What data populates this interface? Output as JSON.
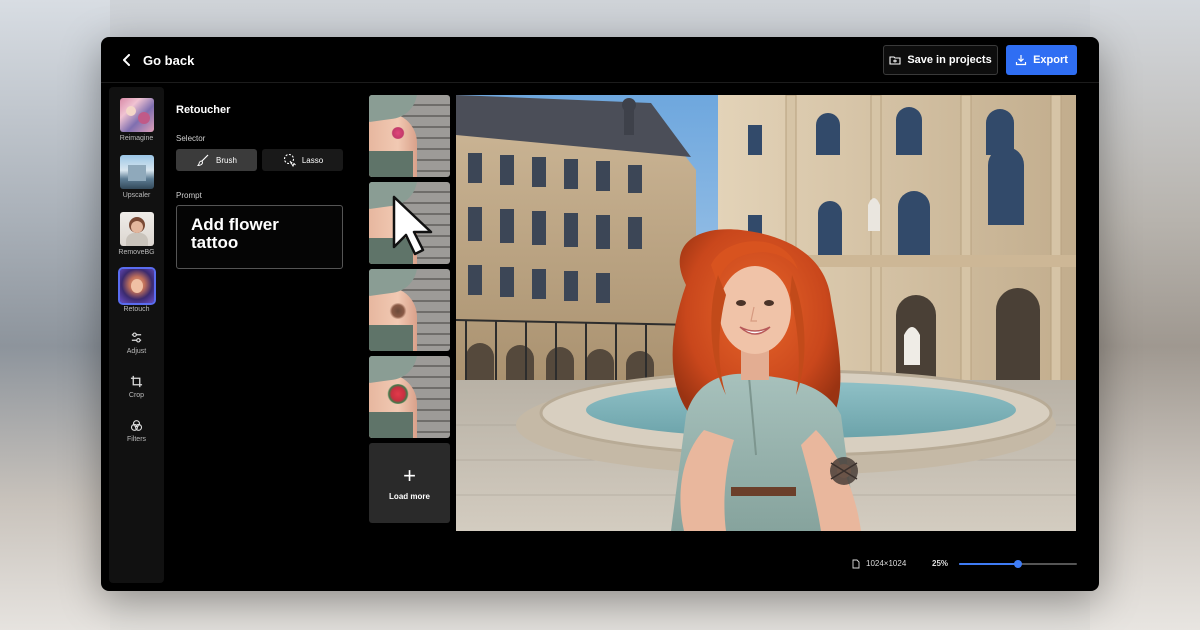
{
  "header": {
    "back_label": "Go back",
    "save_label": "Save in projects",
    "export_label": "Export"
  },
  "rail": {
    "items": [
      {
        "label": "Reimagine",
        "icon": "reimagine-thumb"
      },
      {
        "label": "Upscaler",
        "icon": "upscaler-thumb"
      },
      {
        "label": "RemoveBG",
        "icon": "removebg-thumb"
      },
      {
        "label": "Retouch",
        "icon": "retouch-thumb",
        "active": true
      },
      {
        "label": "Adjust",
        "icon": "sliders-icon"
      },
      {
        "label": "Crop",
        "icon": "crop-icon"
      },
      {
        "label": "Filters",
        "icon": "filters-icon"
      }
    ]
  },
  "panel": {
    "title": "Retoucher",
    "selector_label": "Selector",
    "brush_label": "Brush",
    "lasso_label": "Lasso",
    "prompt_label": "Prompt",
    "prompt_value": "Add flower tattoo"
  },
  "variations": {
    "count": 4,
    "load_more_label": "Load more"
  },
  "status": {
    "dimensions": "1024×1024",
    "zoom_label": "25%",
    "zoom_level": 0.5
  },
  "colors": {
    "accent": "#2f6ef3",
    "background": "#000000",
    "panel": "#111111"
  }
}
